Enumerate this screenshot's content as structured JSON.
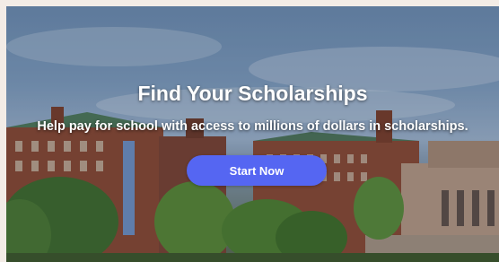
{
  "hero": {
    "title": "Find Your Scholarships",
    "subtitle": "Help pay for school with access to millions of dollars in scholarships.",
    "cta_label": "Start Now"
  },
  "colors": {
    "cta_background": "#5566f2",
    "cta_text": "#ffffff",
    "heading_text": "#ffffff"
  }
}
